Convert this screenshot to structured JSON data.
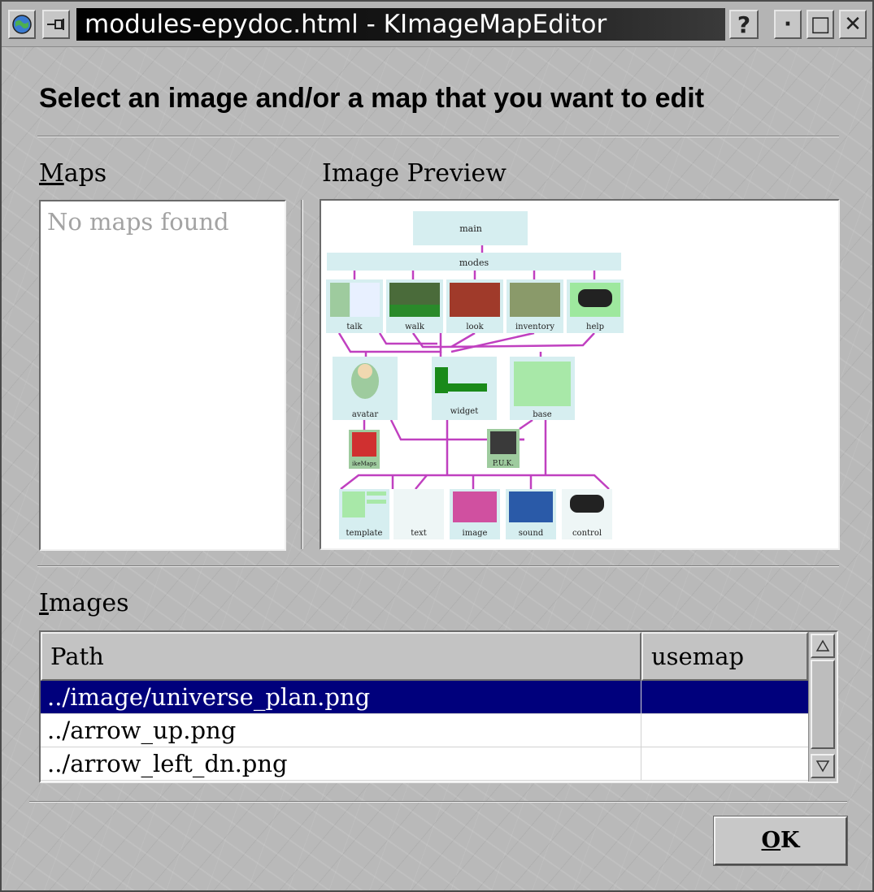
{
  "window": {
    "title": "modules-epydoc.html - KImageMapEditor",
    "buttons": {
      "help": "?",
      "minimize": "·",
      "maximize": "□",
      "close": "✕"
    }
  },
  "heading": "Select an image and/or a map that you want to edit",
  "maps": {
    "label_mnemonic": "M",
    "label_rest": "aps",
    "empty_text": "No maps found"
  },
  "preview": {
    "label": "Image Preview",
    "diagram": {
      "top": [
        "main",
        "modes"
      ],
      "modes": [
        "talk",
        "walk",
        "look",
        "inventory",
        "help"
      ],
      "middle": [
        "avatar",
        "widget",
        "base"
      ],
      "small": [
        "ikeMaps",
        "P.U.K."
      ],
      "bottom": [
        "template",
        "text",
        "image",
        "sound",
        "control"
      ]
    }
  },
  "images": {
    "label_mnemonic": "I",
    "label_rest": "mages",
    "columns": {
      "path": "Path",
      "usemap": "usemap"
    },
    "rows": [
      {
        "path": "../image/universe_plan.png",
        "usemap": ""
      },
      {
        "path": "../arrow_up.png",
        "usemap": ""
      },
      {
        "path": "../arrow_left_dn.png",
        "usemap": ""
      }
    ],
    "selected_row": 0
  },
  "ok_button": {
    "mnemonic": "O",
    "rest": "K"
  },
  "colors": {
    "selection": "#00007c",
    "diagram_box": "#d6eef0",
    "diagram_line": "#c040c0",
    "diagram_green": "#a8e8a8"
  }
}
